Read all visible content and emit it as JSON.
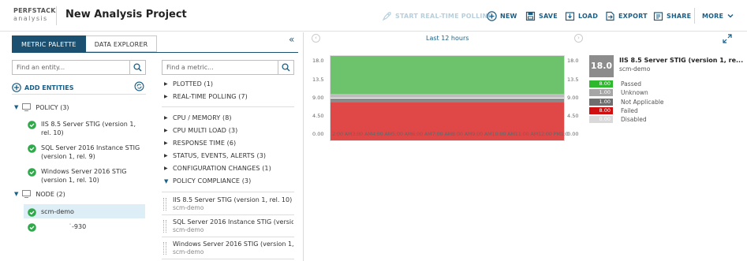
{
  "header": {
    "logo_line1": "PERFSTACK",
    "logo_line2": "analysis",
    "title": "New Analysis Project",
    "toolbar": {
      "realtime": "START REAL-TIME POLLING",
      "new": "NEW",
      "save": "SAVE",
      "load": "LOAD",
      "export": "EXPORT",
      "share": "SHARE",
      "more": "MORE"
    }
  },
  "left": {
    "tabs": [
      "METRIC PALETTE",
      "DATA EXPLORER"
    ],
    "entity_search_placeholder": "Find an entity...",
    "add_entities": "ADD ENTITIES",
    "tree": {
      "policy_label": "POLICY",
      "policy_count": "(3)",
      "policies": [
        "IIS 8.5 Server STIG (version 1, rel. 10)",
        "SQL Server 2016 Instance STIG (version 1, rel. 9)",
        "Windows Server 2016 STIG (version 1, rel. 10)"
      ],
      "node_label": "NODE",
      "node_count": "(2)",
      "nodes": [
        "scm-demo",
        "˙-930"
      ]
    },
    "metric_search_placeholder": "Find a metric...",
    "metric_groups_top": [
      {
        "label": "PLOTTED",
        "count": "(1)"
      },
      {
        "label": "REAL-TIME POLLING",
        "count": "(7)"
      }
    ],
    "metric_groups": [
      {
        "label": "CPU / MEMORY",
        "count": "(8)"
      },
      {
        "label": "CPU MULTI LOAD",
        "count": "(3)"
      },
      {
        "label": "RESPONSE TIME",
        "count": "(6)"
      },
      {
        "label": "STATUS, EVENTS, ALERTS",
        "count": "(3)"
      },
      {
        "label": "CONFIGURATION CHANGES",
        "count": "(1)"
      },
      {
        "label": "POLICY COMPLIANCE",
        "count": "(3)"
      }
    ],
    "policy_compliance_items": [
      {
        "name": "IIS 8.5 Server STIG (version 1, rel. 10)",
        "sub": "scm-demo"
      },
      {
        "name": "SQL Server 2016 Instance STIG (versio...",
        "sub": "scm-demo"
      },
      {
        "name": "Windows Server 2016 STIG (version 1, ...",
        "sub": "scm-demo"
      }
    ]
  },
  "chart": {
    "time_range": "Last 12 hours",
    "yticks_left": [
      "18.0",
      "13.5",
      "9.00",
      "4.50",
      "0.00"
    ],
    "yticks_right": [
      "18.0",
      "13.5",
      "9.00",
      "4.50",
      "0.00"
    ],
    "x_labels": "2:00 AM3:00 AM4:00 AM5:00 AM6:00 AM7:00 AM8:00 AM9:00 AM10:00 AM11:00 AM12:00 PM1:00 PM",
    "colors": {
      "passed": "#6cc36c",
      "unknown": "#bdbdbd",
      "not_applicable": "#8a8a8a",
      "failed": "#e04848",
      "disabled": "#d8d8d8"
    }
  },
  "chart_data": {
    "type": "area",
    "ylim": [
      0,
      18
    ],
    "series": [
      {
        "name": "Passed",
        "values": [
          8,
          8,
          8,
          8,
          8,
          8,
          8,
          8,
          8,
          8,
          8,
          8
        ]
      },
      {
        "name": "Unknown",
        "values": [
          1,
          1,
          1,
          1,
          1,
          1,
          1,
          1,
          1,
          1,
          1,
          1
        ]
      },
      {
        "name": "Not Applicable",
        "values": [
          1,
          1,
          1,
          1,
          1,
          1,
          1,
          1,
          1,
          1,
          1,
          1
        ]
      },
      {
        "name": "Failed",
        "values": [
          8,
          8,
          8,
          8,
          8,
          8,
          8,
          8,
          8,
          8,
          8,
          8
        ]
      },
      {
        "name": "Disabled",
        "values": [
          0,
          0,
          0,
          0,
          0,
          0,
          0,
          0,
          0,
          0,
          0,
          0
        ]
      }
    ]
  },
  "summary": {
    "total": "18.0",
    "title": "IIS 8.5 Server STIG (version 1, re...",
    "subtitle": "scm-demo",
    "legend": [
      {
        "value": "8.00",
        "name": "Passed",
        "color": "#2eb82e"
      },
      {
        "value": "1.00",
        "name": "Unknown",
        "color": "#a6a6a6"
      },
      {
        "value": "1.00",
        "name": "Not Applicable",
        "color": "#6e6e6e"
      },
      {
        "value": "8.00",
        "name": "Failed",
        "color": "#d01010"
      },
      {
        "value": "0.00",
        "name": "Disabled",
        "color": "#d9d9d9"
      }
    ]
  }
}
